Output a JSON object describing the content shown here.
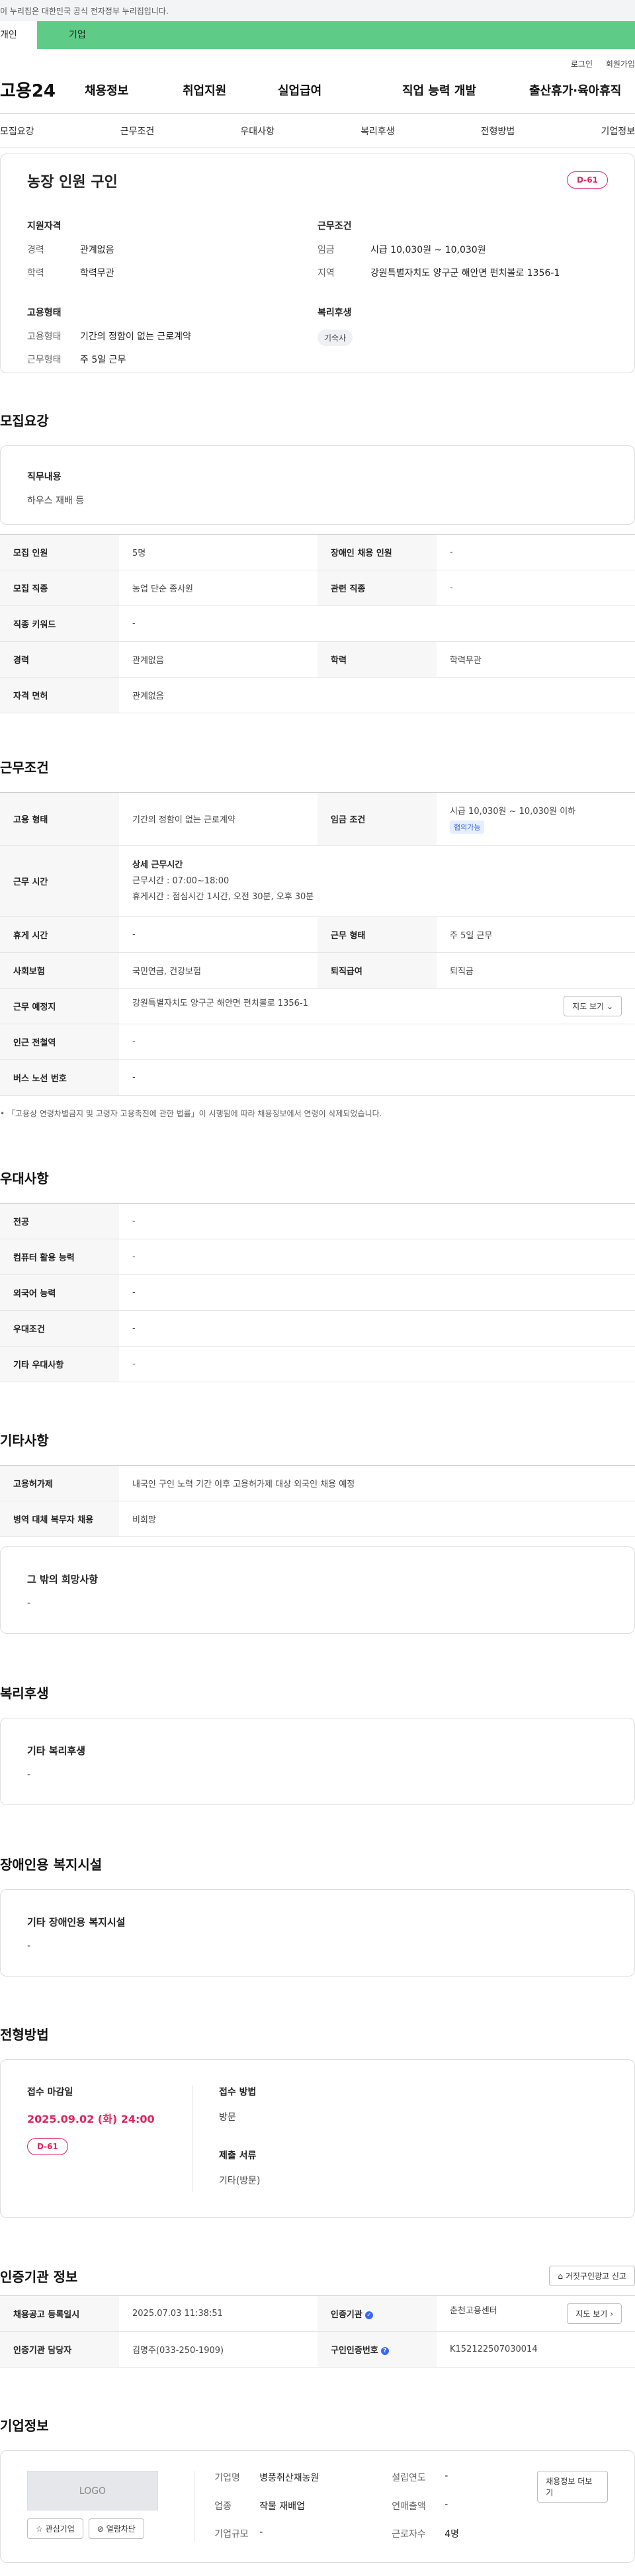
{
  "gov_bar": "이 누리집은 대한민국 공식 전자정부 누리집입니다.",
  "user_tabs": [
    "개인",
    "기업"
  ],
  "util_links": [
    "로그인",
    "회원가입"
  ],
  "gnb": {
    "logo": "고용24",
    "menu": [
      "채용정보",
      "취업지원",
      "실업급여",
      "직업 능력 개발",
      "출산휴가·육아휴직"
    ]
  },
  "subnav": [
    "모집요강",
    "근무조건",
    "우대사항",
    "복리후생",
    "전형방법",
    "기업정보"
  ],
  "summary": {
    "title": "농장 인원 구인",
    "dday": "D-61",
    "qual_title": "지원자격",
    "qual": [
      {
        "k": "경력",
        "v": "관계없음"
      },
      {
        "k": "학력",
        "v": "학력무관"
      }
    ],
    "cond_title": "근무조건",
    "cond": [
      {
        "k": "임금",
        "v": "시급 10,030원 ~ 10,030원"
      },
      {
        "k": "지역",
        "v": "강원특별자치도 양구군 해안면 펀치볼로 1356-1"
      }
    ],
    "emp_title": "고용형태",
    "emp": [
      {
        "k": "고용형태",
        "v": "기간의 정함이 없는 근로계약"
      },
      {
        "k": "근무형태",
        "v": "주 5일 근무"
      }
    ],
    "welfare_title": "복리후생",
    "welfare_chip": "기숙사"
  },
  "recruit": {
    "title": "모집요강",
    "duty_label": "직무내용",
    "duty_value": "하우스 재배 등",
    "rows": [
      [
        "모집 인원",
        "5명",
        "장애인 채용 인원",
        "-"
      ],
      [
        "모집 직종",
        "농업 단순 종사원",
        "관련 직종",
        "-"
      ],
      [
        "직종 키워드",
        "-"
      ],
      [
        "경력",
        "관계없음",
        "학력",
        "학력무관"
      ],
      [
        "자격 면허",
        "관계없음"
      ]
    ]
  },
  "work": {
    "title": "근무조건",
    "emp_type_label": "고용 형태",
    "emp_type": "기간의 정함이 없는 근로계약",
    "wage_label": "임금 조건",
    "wage": "시급 10,030원 ~ 10,030원 이하",
    "wage_badge": "협의가능",
    "hours_label": "근무 시간",
    "hours_title": "상세 근무시간",
    "hours_1": "근무시간 : 07:00~18:00",
    "hours_2": "휴게시간 : 점심시간 1시간, 오전 30분, 오후 30분",
    "rows": [
      [
        "휴게 시간",
        "-",
        "근무 형태",
        "주 5일 근무"
      ],
      [
        "사회보험",
        "국민연금, 건강보험",
        "퇴직급여",
        "퇴직금"
      ]
    ],
    "place_label": "근무 예정지",
    "place": "강원특별자치도 양구군 해안면 펀치볼로 1356-1",
    "map_btn": "지도 보기",
    "rows2": [
      [
        "인근 전철역",
        "-"
      ],
      [
        "버스 노선 번호",
        "-"
      ]
    ],
    "note": "「고용상 연령차별금지 및 고령자 고용촉진에 관한 법률」이 시행됨에 따라 채용정보에서 연령이 삭제되었습니다."
  },
  "pref": {
    "title": "우대사항",
    "rows": [
      [
        "전공",
        "-"
      ],
      [
        "컴퓨터 활용 능력",
        "-"
      ],
      [
        "외국어 능력",
        "-"
      ],
      [
        "우대조건",
        "-"
      ],
      [
        "기타 우대사항",
        "-"
      ]
    ]
  },
  "etc": {
    "title": "기타사항",
    "rows": [
      [
        "고용허가제",
        "내국인 구인 노력 기간 이후 고용허가제 대상 외국인 채용 예정"
      ],
      [
        "병역 대체 복무자 채용",
        "비희망"
      ]
    ],
    "box_label": "그 밖의 희망사항",
    "box_value": "-"
  },
  "welfare": {
    "title": "복리후생",
    "box_label": "기타 복리후생",
    "box_value": "-"
  },
  "disabled": {
    "title": "장애인용 복지시설",
    "box_label": "기타 장애인용 복지시설",
    "box_value": "-"
  },
  "apply": {
    "title": "전형방법",
    "deadline_label": "접수 마감일",
    "deadline": "2025.09.02 (화) 24:00",
    "dday": "D-61",
    "method_label": "접수 방법",
    "method": "방문",
    "docs_label": "제출 서류",
    "docs": "기타(방문)"
  },
  "agency": {
    "title": "인증기관 정보",
    "report_btn": "거짓구인광고 신고",
    "rows": [
      [
        "채용공고 등록일시",
        "2025.07.03 11:38:51",
        "인증기관",
        "춘천고용센터"
      ],
      [
        "인증기관 담당자",
        "김명주(033-250-1909)",
        "구인인증번호",
        "K152122507030014"
      ]
    ],
    "map_btn": "지도 보기"
  },
  "company": {
    "title": "기업정보",
    "logo": "LOGO",
    "fav_btn": "관심기업",
    "block_btn": "열람차단",
    "info": [
      [
        "기업명",
        "병풍취산채농원",
        "설립연도",
        "-"
      ],
      [
        "업종",
        "작물 재배업",
        "연매출액",
        "-"
      ],
      [
        "기업규모",
        "-",
        "근로자수",
        "4명"
      ]
    ],
    "jobs_btn": "채용정보 더보기"
  }
}
